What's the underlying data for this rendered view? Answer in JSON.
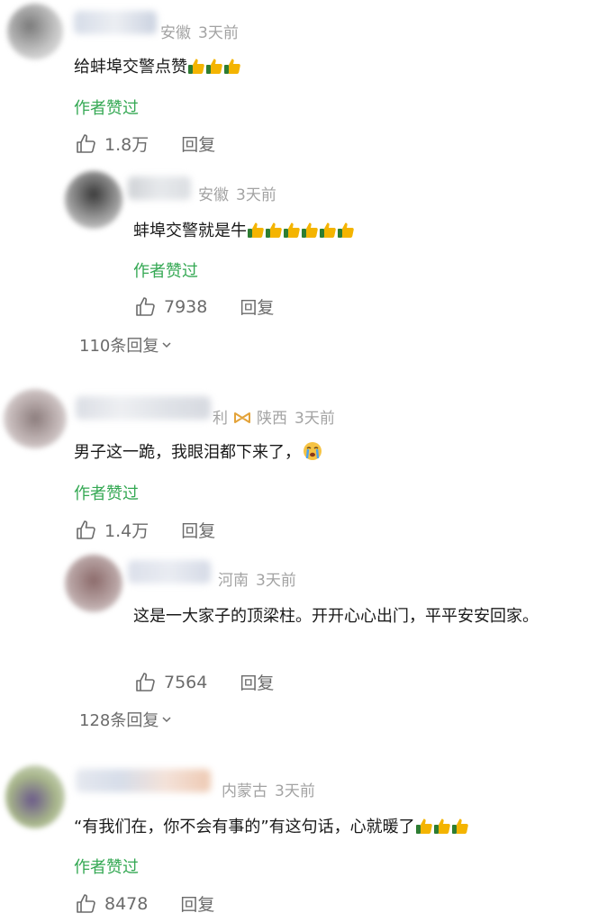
{
  "comments": [
    {
      "location": "安徽",
      "time": "3天前",
      "text": "给蚌埠交警点赞",
      "author_liked": "作者赞过",
      "likes": "1.8万",
      "reply_label": "回复",
      "reply": {
        "location": "安徽",
        "time": "3天前",
        "text": "蚌埠交警就是牛",
        "author_liked": "作者赞过",
        "likes": "7938",
        "reply_label": "回复"
      },
      "more_replies": "110条回复"
    },
    {
      "name_fragment": "利",
      "location": "陕西",
      "time": "3天前",
      "text": "男子这一跪，我眼泪都下来了，",
      "author_liked": "作者赞过",
      "likes": "1.4万",
      "reply_label": "回复",
      "reply": {
        "location": "河南",
        "time": "3天前",
        "text": "这是一大家子的顶梁柱。开开心心出门，平平安安回家。",
        "likes": "7564",
        "reply_label": "回复"
      },
      "more_replies": "128条回复"
    },
    {
      "location": "内蒙古",
      "time": "3天前",
      "text": "“有我们在，你不会有事的”有这句话，心就暖了",
      "author_liked": "作者赞过",
      "likes": "8478",
      "reply_label": "回复"
    }
  ],
  "colors": {
    "author_liked": "#34a853",
    "meta": "#a3a3a3",
    "action": "#6b6b6b"
  },
  "icons": {
    "like": "thumbs-up-outline-icon",
    "emoji_thumb": "thumbs-up-emoji-icon",
    "emoji_cry": "crying-face-emoji-icon",
    "badge": "bow-badge-icon",
    "chevron": "chevron-down-icon"
  }
}
